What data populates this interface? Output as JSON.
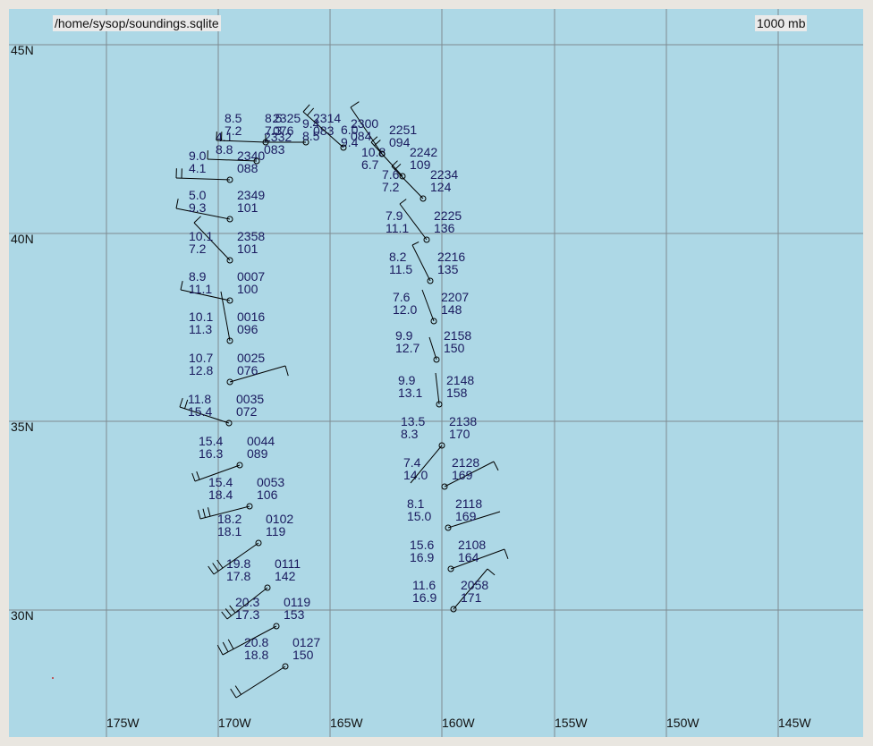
{
  "header": {
    "file_path": "/home/sysop/soundings.sqlite",
    "level": "1000 mb"
  },
  "map": {
    "background": "#add8e6",
    "grid_color": "#7f8a90",
    "station_color": "#1a1a5e",
    "lat_labels": [
      "45N",
      "40N",
      "35N",
      "30N"
    ],
    "lon_labels": [
      "175W",
      "170W",
      "165W",
      "160W",
      "155W",
      "150W",
      "145W"
    ]
  },
  "tracks": [
    {
      "name": "western-track",
      "points": [
        {
          "time": "0127",
          "temp": "20.8",
          "dew": "18.8",
          "hgt": "150"
        },
        {
          "time": "0119",
          "temp": "20.3",
          "dew": "17.3",
          "hgt": "153"
        },
        {
          "time": "0111",
          "temp": "19.8",
          "dew": "17.8",
          "hgt": "142"
        },
        {
          "time": "0102",
          "temp": "18.2",
          "dew": "18.1",
          "hgt": "119"
        },
        {
          "time": "0053",
          "temp": "15.4",
          "dew": "18.4",
          "hgt": "106"
        },
        {
          "time": "0044",
          "temp": "15.4",
          "dew": "16.3",
          "hgt": "089"
        },
        {
          "time": "0035",
          "temp": "11.8",
          "dew": "15.4",
          "hgt": "072"
        },
        {
          "time": "0025",
          "temp": "10.7",
          "dew": "12.8",
          "hgt": "076"
        },
        {
          "time": "0016",
          "temp": "10.1",
          "dew": "11.3",
          "hgt": "096"
        },
        {
          "time": "0007",
          "temp": "8.9",
          "dew": "11.1",
          "hgt": "100"
        },
        {
          "time": "2358",
          "temp": "10.1",
          "dew": "7.2",
          "hgt": "101"
        },
        {
          "time": "2349",
          "temp": "5.0",
          "dew": "9.3",
          "hgt": "101"
        },
        {
          "time": "2340",
          "temp": "9.0",
          "dew": "4.1",
          "hgt": "088"
        },
        {
          "time": "2332",
          "temp": "4.1",
          "dew": "8.8",
          "hgt": "083"
        },
        {
          "time": "2325",
          "temp": "8.5",
          "dew": "7.2",
          "hgt": "076"
        },
        {
          "time": "2314",
          "temp": "8.5",
          "dew": "7.3",
          "hgt": "083"
        }
      ]
    },
    {
      "name": "eastern-track",
      "points": [
        {
          "time": "2058",
          "temp": "11.6",
          "dew": "16.9",
          "hgt": "171"
        },
        {
          "time": "2108",
          "temp": "15.6",
          "dew": "16.9",
          "hgt": "164"
        },
        {
          "time": "2118",
          "temp": "8.1",
          "dew": "15.0",
          "hgt": "169"
        },
        {
          "time": "2128",
          "temp": "7.4",
          "dew": "14.0",
          "hgt": "169"
        },
        {
          "time": "2138",
          "temp": "13.5",
          "dew": "8.3",
          "hgt": "170"
        },
        {
          "time": "2148",
          "temp": "9.9",
          "dew": "13.1",
          "hgt": "158"
        },
        {
          "time": "2158",
          "temp": "9.9",
          "dew": "12.7",
          "hgt": "150"
        },
        {
          "time": "2207",
          "temp": "7.6",
          "dew": "12.0",
          "hgt": "148"
        },
        {
          "time": "2216",
          "temp": "8.2",
          "dew": "11.5",
          "hgt": "135"
        },
        {
          "time": "2225",
          "temp": "7.9",
          "dew": "11.1",
          "hgt": "136"
        },
        {
          "time": "2234",
          "temp": "7.6",
          "dew": "7.2",
          "hgt": "124"
        },
        {
          "time": "2242",
          "temp": "10.8",
          "dew": "6.7",
          "hgt": "109"
        },
        {
          "time": "2251",
          "temp": "6.0",
          "dew": "9.4",
          "hgt": "094"
        },
        {
          "time": "2300",
          "temp": "9.4",
          "dew": "8.5",
          "hgt": "084"
        }
      ]
    }
  ]
}
